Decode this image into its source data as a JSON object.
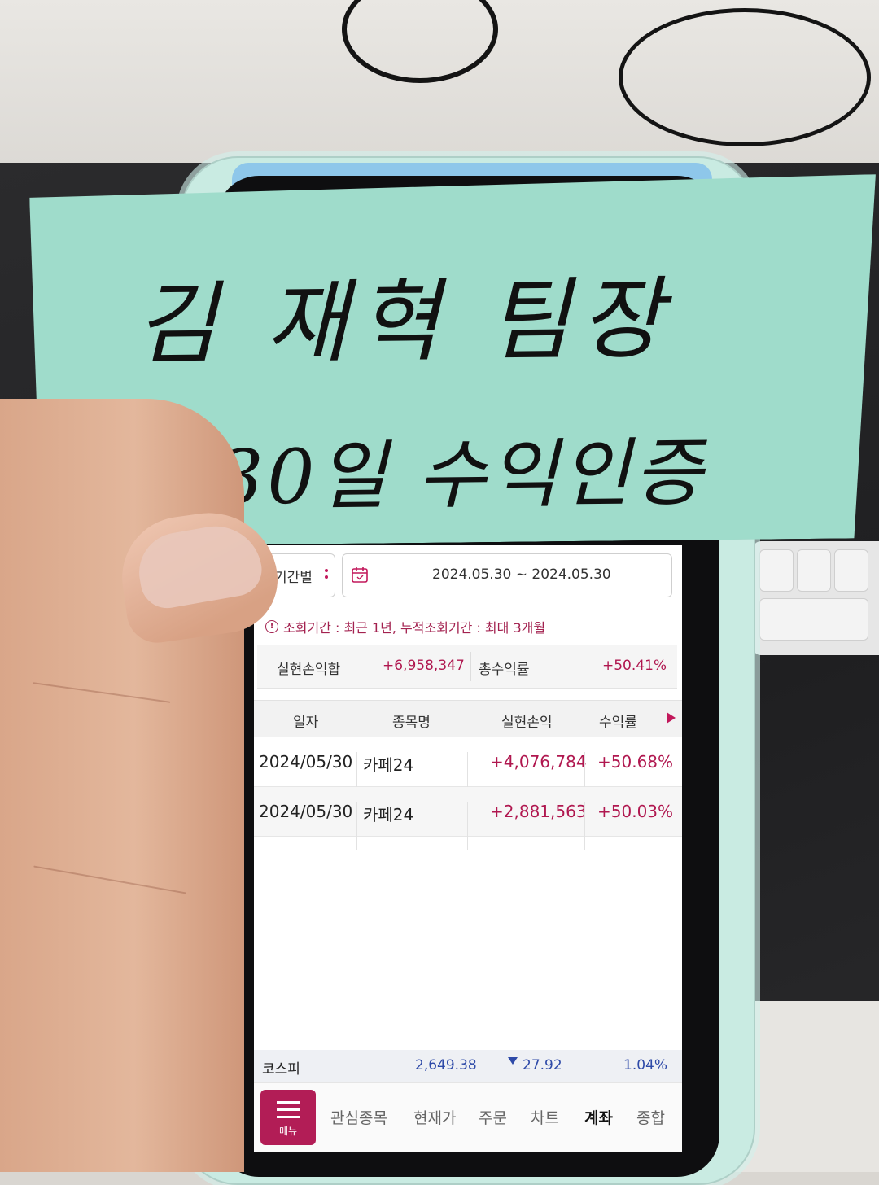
{
  "note": {
    "line1": "김 재혁 팀장",
    "line2": "5.30일 수익인증"
  },
  "filter": {
    "period_label": "기간별",
    "date_range": "2024.05.30 ~ 2024.05.30"
  },
  "notice": "조회기간 : 최근 1년, 누적조회기간 : 최대 3개월",
  "summary": {
    "realized_label": "실현손익합",
    "realized_value": "+6,958,347",
    "return_label": "총수익률",
    "return_value": "+50.41%"
  },
  "table": {
    "headers": [
      "일자",
      "종목명",
      "실현손익",
      "수익률"
    ],
    "rows": [
      {
        "date": "2024/05/30",
        "name": "카페24",
        "pnl": "+4,076,784",
        "rate": "+50.68%"
      },
      {
        "date": "2024/05/30",
        "name": "카페24",
        "pnl": "+2,881,563",
        "rate": "+50.03%"
      }
    ]
  },
  "index_bar": {
    "name": "코스피",
    "value": "2,649.38",
    "change": "27.92",
    "percent": "1.04%"
  },
  "nav": {
    "menu": "메뉴",
    "items": [
      "관심종목",
      "현재가",
      "주문",
      "차트",
      "계좌",
      "종합"
    ],
    "active_index": 4
  },
  "colors": {
    "accent": "#b21d56",
    "positive": "#b0174f",
    "negative": "#2e4aa8",
    "note": "#9fdccb"
  }
}
